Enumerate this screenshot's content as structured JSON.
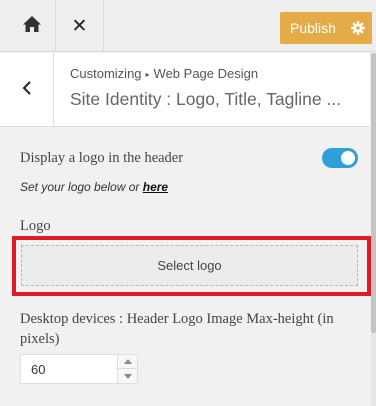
{
  "toolbar": {
    "home_icon": "home-icon",
    "close_glyph": "✕",
    "publish_label": "Publish",
    "publish_gear_icon": "gear-icon",
    "publish_color": "#e3ac49"
  },
  "section": {
    "back_icon": "chevron-left-icon",
    "breadcrumb_root": "Customizing",
    "breadcrumb_sep": "▸",
    "breadcrumb_panel": "Web Page Design",
    "title": "Site Identity : Logo, Title, Tagline ..."
  },
  "logo_toggle": {
    "label": "Display a logo in the header",
    "enabled": true,
    "accent": "#2f9fd8"
  },
  "hint": {
    "text": "Set your logo below or ",
    "link": "here"
  },
  "logo": {
    "label": "Logo",
    "button_label": "Select logo",
    "highlight_color": "#e01b24"
  },
  "max_height": {
    "label": "Desktop devices : Header Logo Image Max-height (in pixels)",
    "value": "60"
  }
}
